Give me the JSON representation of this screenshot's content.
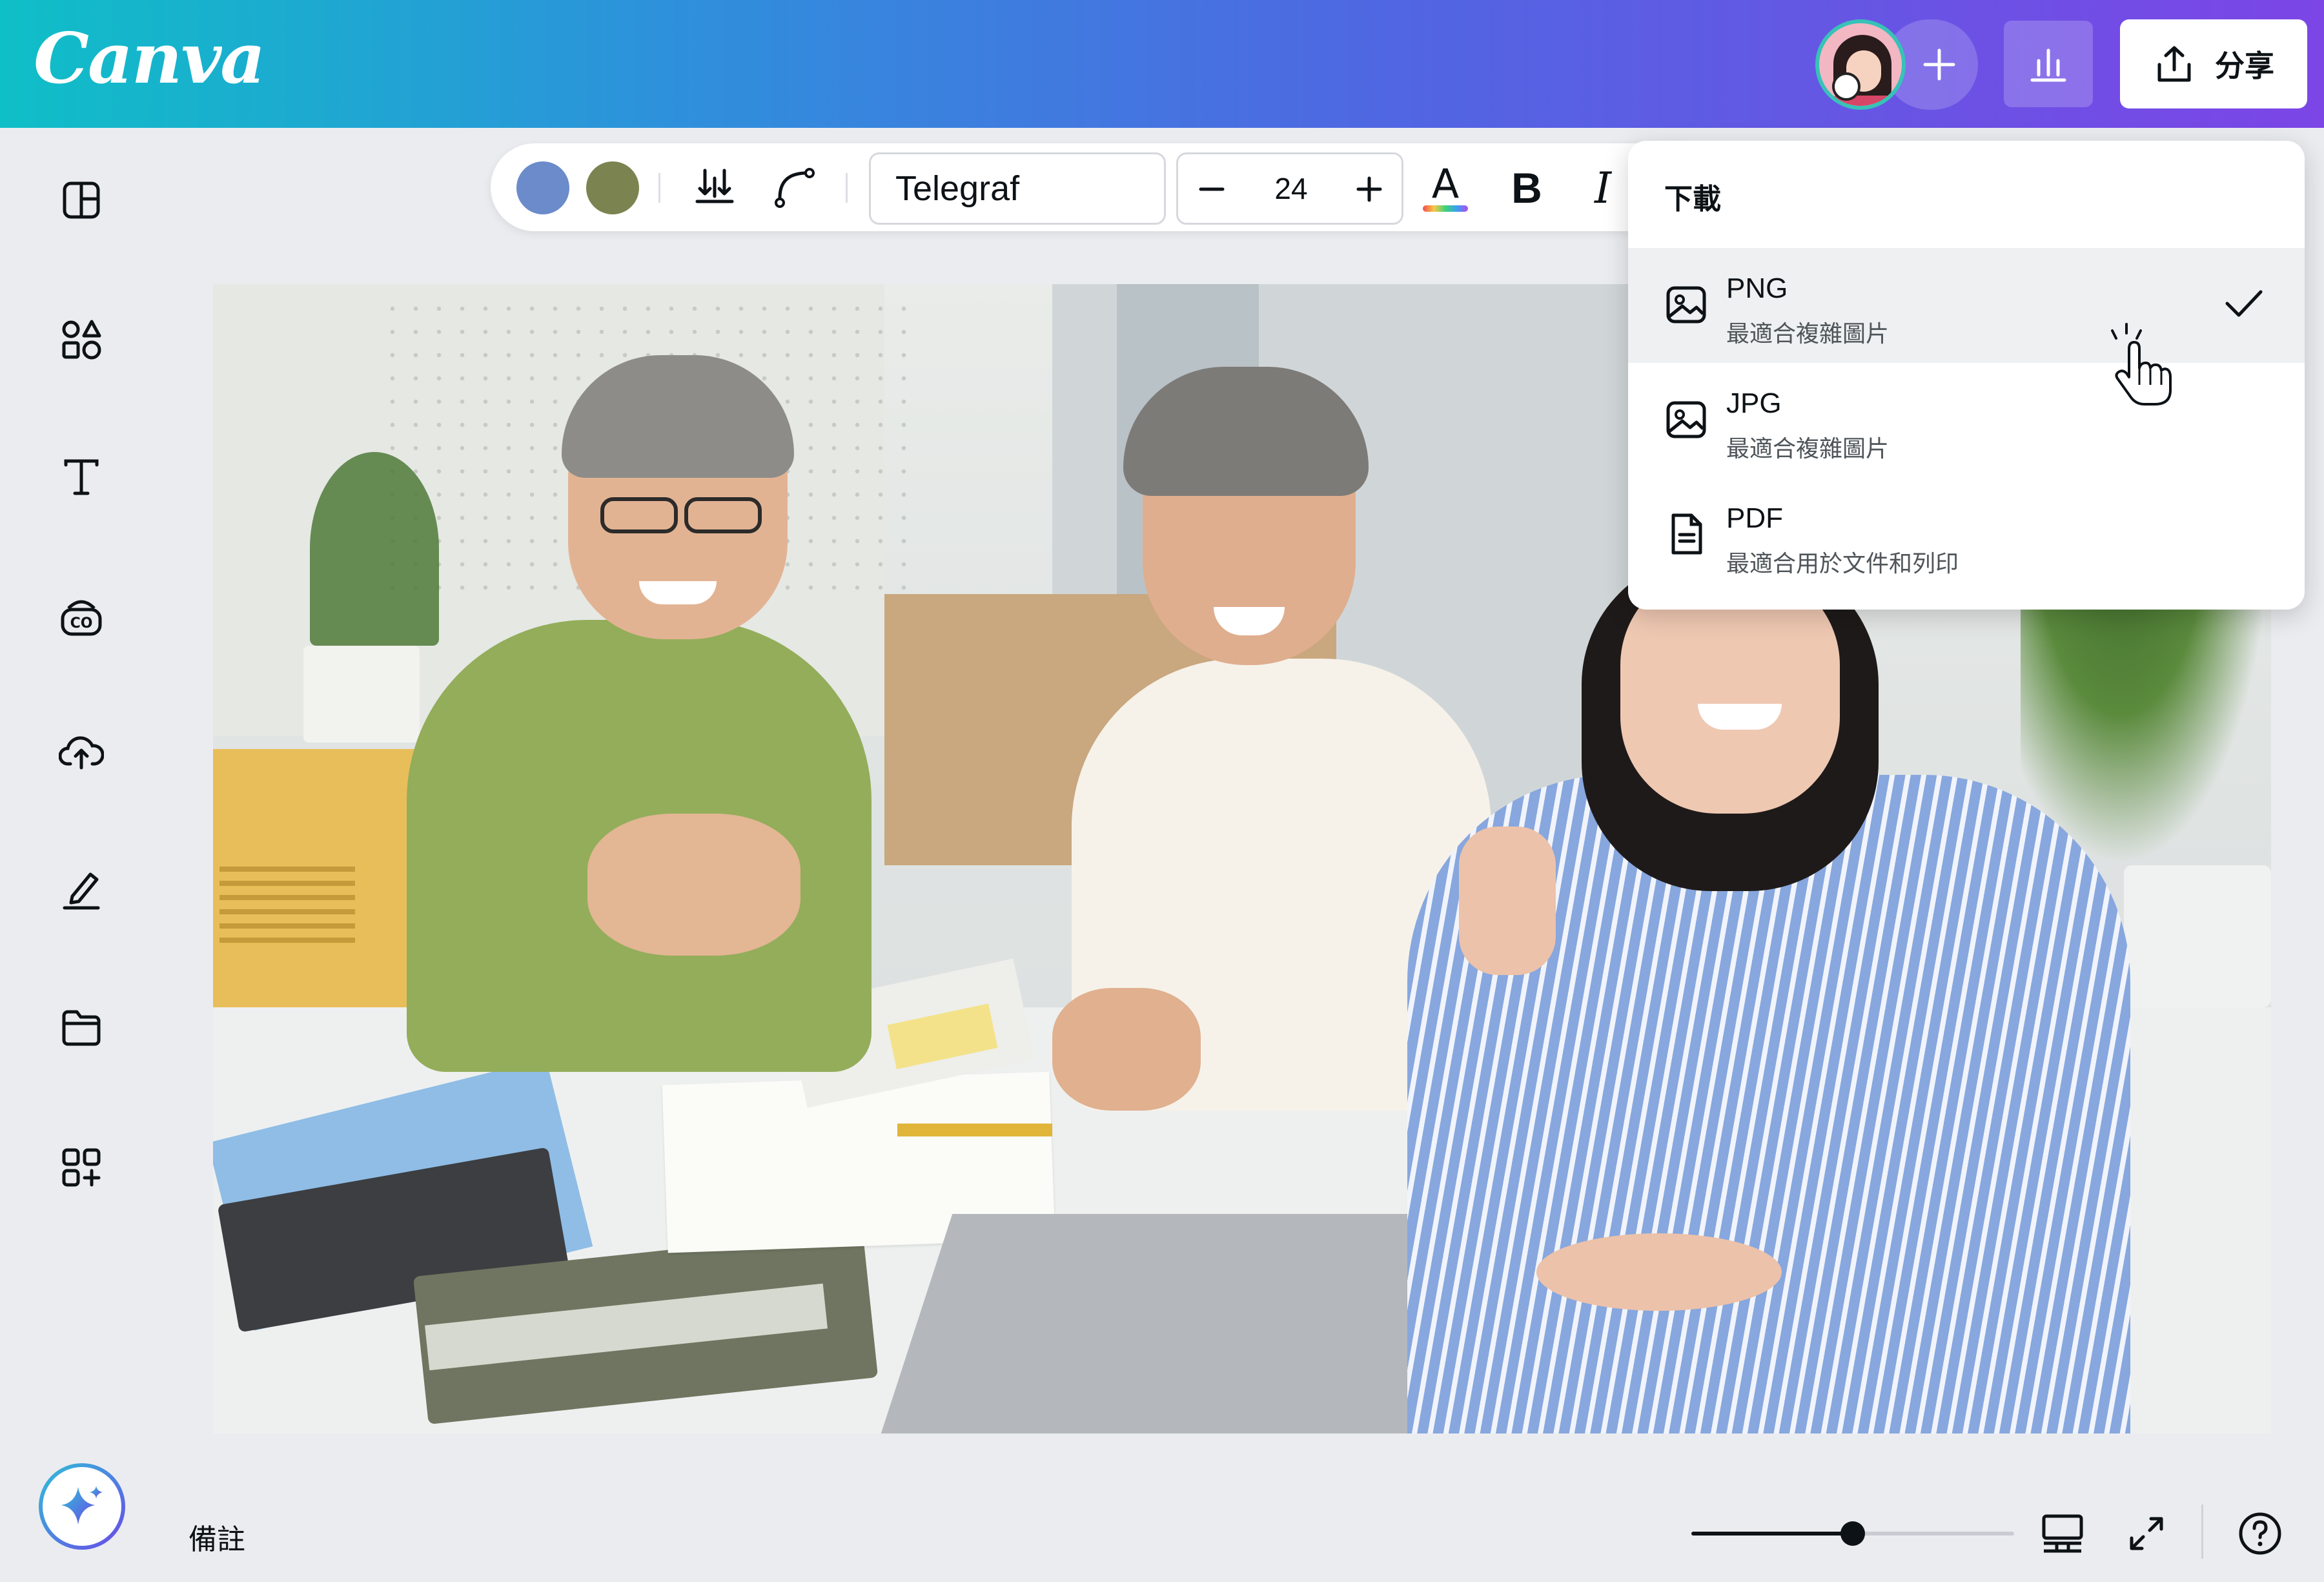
{
  "app": {
    "logo_text": "Canva"
  },
  "header": {
    "share_label": "分享",
    "avatar_alt": "user avatar",
    "invite_icon": "plus-icon",
    "analytics_icon": "bar-chart-icon",
    "share_icon": "upload-icon"
  },
  "sidebar": {
    "items": [
      {
        "icon": "design-layout-icon"
      },
      {
        "icon": "elements-shapes-icon"
      },
      {
        "icon": "text-icon"
      },
      {
        "icon": "brand-kit-icon"
      },
      {
        "icon": "uploads-cloud-icon"
      },
      {
        "icon": "draw-pen-icon"
      },
      {
        "icon": "projects-folder-icon"
      },
      {
        "icon": "apps-grid-icon"
      }
    ],
    "magic_icon": "sparkle-icon"
  },
  "toolbar": {
    "color1": "#6b8bca",
    "color2": "#7b8451",
    "font_name": "Telegraf",
    "font_size": "24",
    "text_color_letter": "A",
    "bold_label": "B",
    "italic_label": "I"
  },
  "download_menu": {
    "title": "下載",
    "options": [
      {
        "name": "PNG",
        "desc": "最適合複雜圖片",
        "icon": "image-icon",
        "selected": true
      },
      {
        "name": "JPG",
        "desc": "最適合複雜圖片",
        "icon": "image-icon",
        "selected": false
      },
      {
        "name": "PDF",
        "desc": "最適合用於文件和列印",
        "icon": "document-icon",
        "selected": false
      }
    ]
  },
  "footer": {
    "notes_label": "備註",
    "zoom_level": 0.5
  }
}
